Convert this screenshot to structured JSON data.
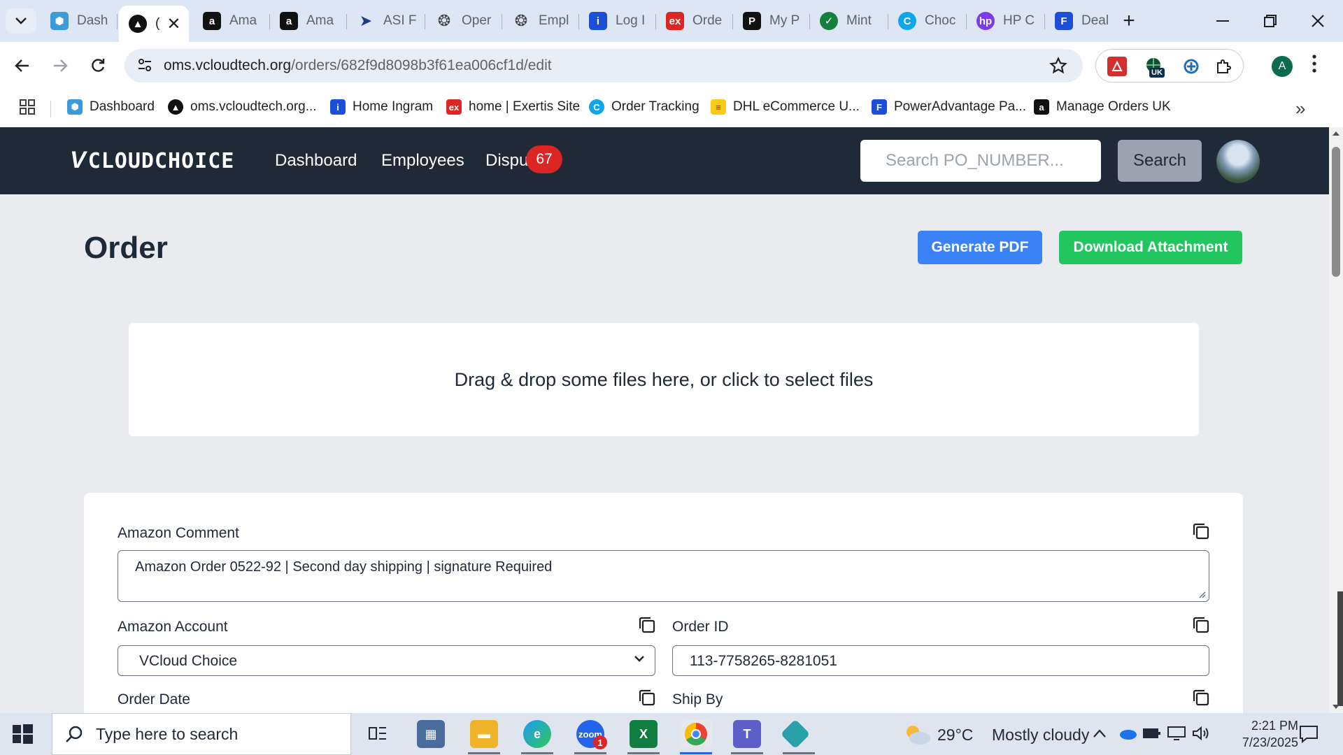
{
  "browser": {
    "tabs": [
      {
        "label": "Dash",
        "icon": "hexagon-icon",
        "color": "#3b9ad9"
      },
      {
        "label": "(",
        "icon": "triangle-logo-icon",
        "color": "#111111",
        "active": true
      },
      {
        "label": "Ama",
        "icon": "amazon-icon",
        "color": "#111111"
      },
      {
        "label": "Ama",
        "icon": "amazon-icon",
        "color": "#111111"
      },
      {
        "label": "ASI F",
        "icon": "arrow-icon",
        "color": "#1e3a8a"
      },
      {
        "label": "Oper",
        "icon": "openai-icon",
        "color": "#444444"
      },
      {
        "label": "Empl",
        "icon": "openai-icon",
        "color": "#444444"
      },
      {
        "label": "Log I",
        "icon": "ingram-icon",
        "color": "#1d4ed8"
      },
      {
        "label": "Orde",
        "icon": "exertis-icon",
        "color": "#dc2626"
      },
      {
        "label": "My P",
        "icon": "parcel-icon",
        "color": "#111111"
      },
      {
        "label": "Mint",
        "icon": "mint-icon",
        "color": "#15803d"
      },
      {
        "label": "Choc",
        "icon": "choc-icon",
        "color": "#0ea5e9"
      },
      {
        "label": "HP C",
        "icon": "hp-icon",
        "color": "#7c3aed"
      },
      {
        "label": "Deal",
        "icon": "doc-icon",
        "color": "#1d4ed8"
      }
    ],
    "url_host": "oms.vcloudtech.org",
    "url_path": "/orders/682f9d8098b3f61ea006cf1d/edit",
    "profile_initial": "A",
    "ext_badge": "UK",
    "bookmarks": [
      {
        "label": "Dashboard",
        "icon": "hexagon-icon",
        "color": "#3b9ad9"
      },
      {
        "label": "oms.vcloudtech.org...",
        "icon": "triangle-logo-icon",
        "color": "#111111"
      },
      {
        "label": "Home Ingram",
        "icon": "ingram-icon",
        "color": "#1d4ed8"
      },
      {
        "label": "home | Exertis Site",
        "icon": "exertis-icon",
        "color": "#dc2626"
      },
      {
        "label": "Order Tracking",
        "icon": "choc-icon",
        "color": "#0ea5e9"
      },
      {
        "label": "DHL eCommerce U...",
        "icon": "dhl-icon",
        "color": "#facc15"
      },
      {
        "label": "PowerAdvantage Pa...",
        "icon": "doc-icon",
        "color": "#1d4ed8"
      },
      {
        "label": "Manage Orders UK",
        "icon": "amazon-icon",
        "color": "#111111"
      }
    ]
  },
  "app": {
    "logo_v": "V",
    "logo_text": "CLOUDCHOICE",
    "nav": [
      "Dashboard",
      "Employees",
      "Dispu"
    ],
    "disputes_badge": "67",
    "search_placeholder": "Search PO_NUMBER...",
    "search_button": "Search"
  },
  "page": {
    "title": "Order",
    "generate_pdf": "Generate PDF",
    "download_attachment": "Download Attachment",
    "dropzone_text": "Drag & drop some files here, or click to select files",
    "fields": {
      "amazon_comment_label": "Amazon Comment",
      "amazon_comment_value": "Amazon Order 0522-92 | Second day shipping | signature Required",
      "amazon_account_label": "Amazon Account",
      "amazon_account_value": "VCloud Choice",
      "order_id_label": "Order ID",
      "order_id_value": "113-7758265-8281051",
      "order_date_label": "Order Date",
      "ship_by_label": "Ship By"
    }
  },
  "taskbar": {
    "search_text": "Type here to search",
    "weather_temp": "29°C",
    "weather_text": "Mostly cloudy",
    "time": "2:21 PM",
    "date": "7/23/2025",
    "zoom_badge": "1"
  },
  "colors": {
    "nav_bg": "#1f2937",
    "primary_blue": "#3b82f6",
    "success_green": "#22c55e",
    "badge_red": "#dc2626"
  }
}
